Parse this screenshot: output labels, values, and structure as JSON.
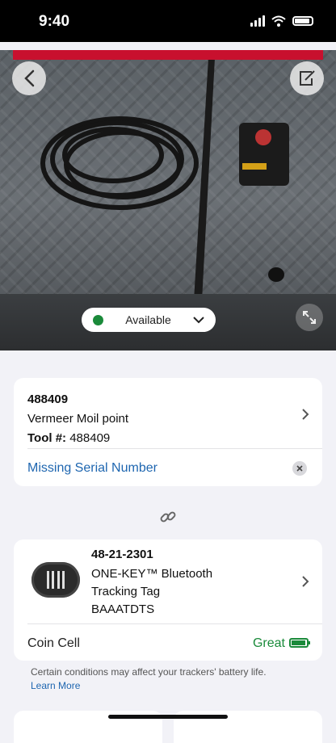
{
  "status_bar": {
    "time": "9:40"
  },
  "photo": {
    "availability_label": "Available",
    "availability_color": "#1a8a3a"
  },
  "asset": {
    "number": "488409",
    "name": "Vermeer Moil point",
    "tool_label": "Tool #:",
    "tool_number": "488409",
    "missing_serial": "Missing Serial Number"
  },
  "tracker": {
    "model": "48-21-2301",
    "name": "ONE-KEY™ Bluetooth Tracking Tag",
    "id": "BAAATDTS",
    "battery_type": "Coin Cell",
    "battery_status": "Great"
  },
  "note": {
    "text": "Certain conditions may affect your trackers' battery life.",
    "link": "Learn More"
  },
  "colors": {
    "accent": "#1e66b0",
    "success": "#1a8a3a",
    "brand_red": "#c8102e"
  },
  "icons": [
    "back-icon",
    "edit-icon",
    "expand-icon",
    "chevron-down-icon",
    "chevron-right-icon",
    "close-icon",
    "link-icon",
    "battery-icon"
  ]
}
